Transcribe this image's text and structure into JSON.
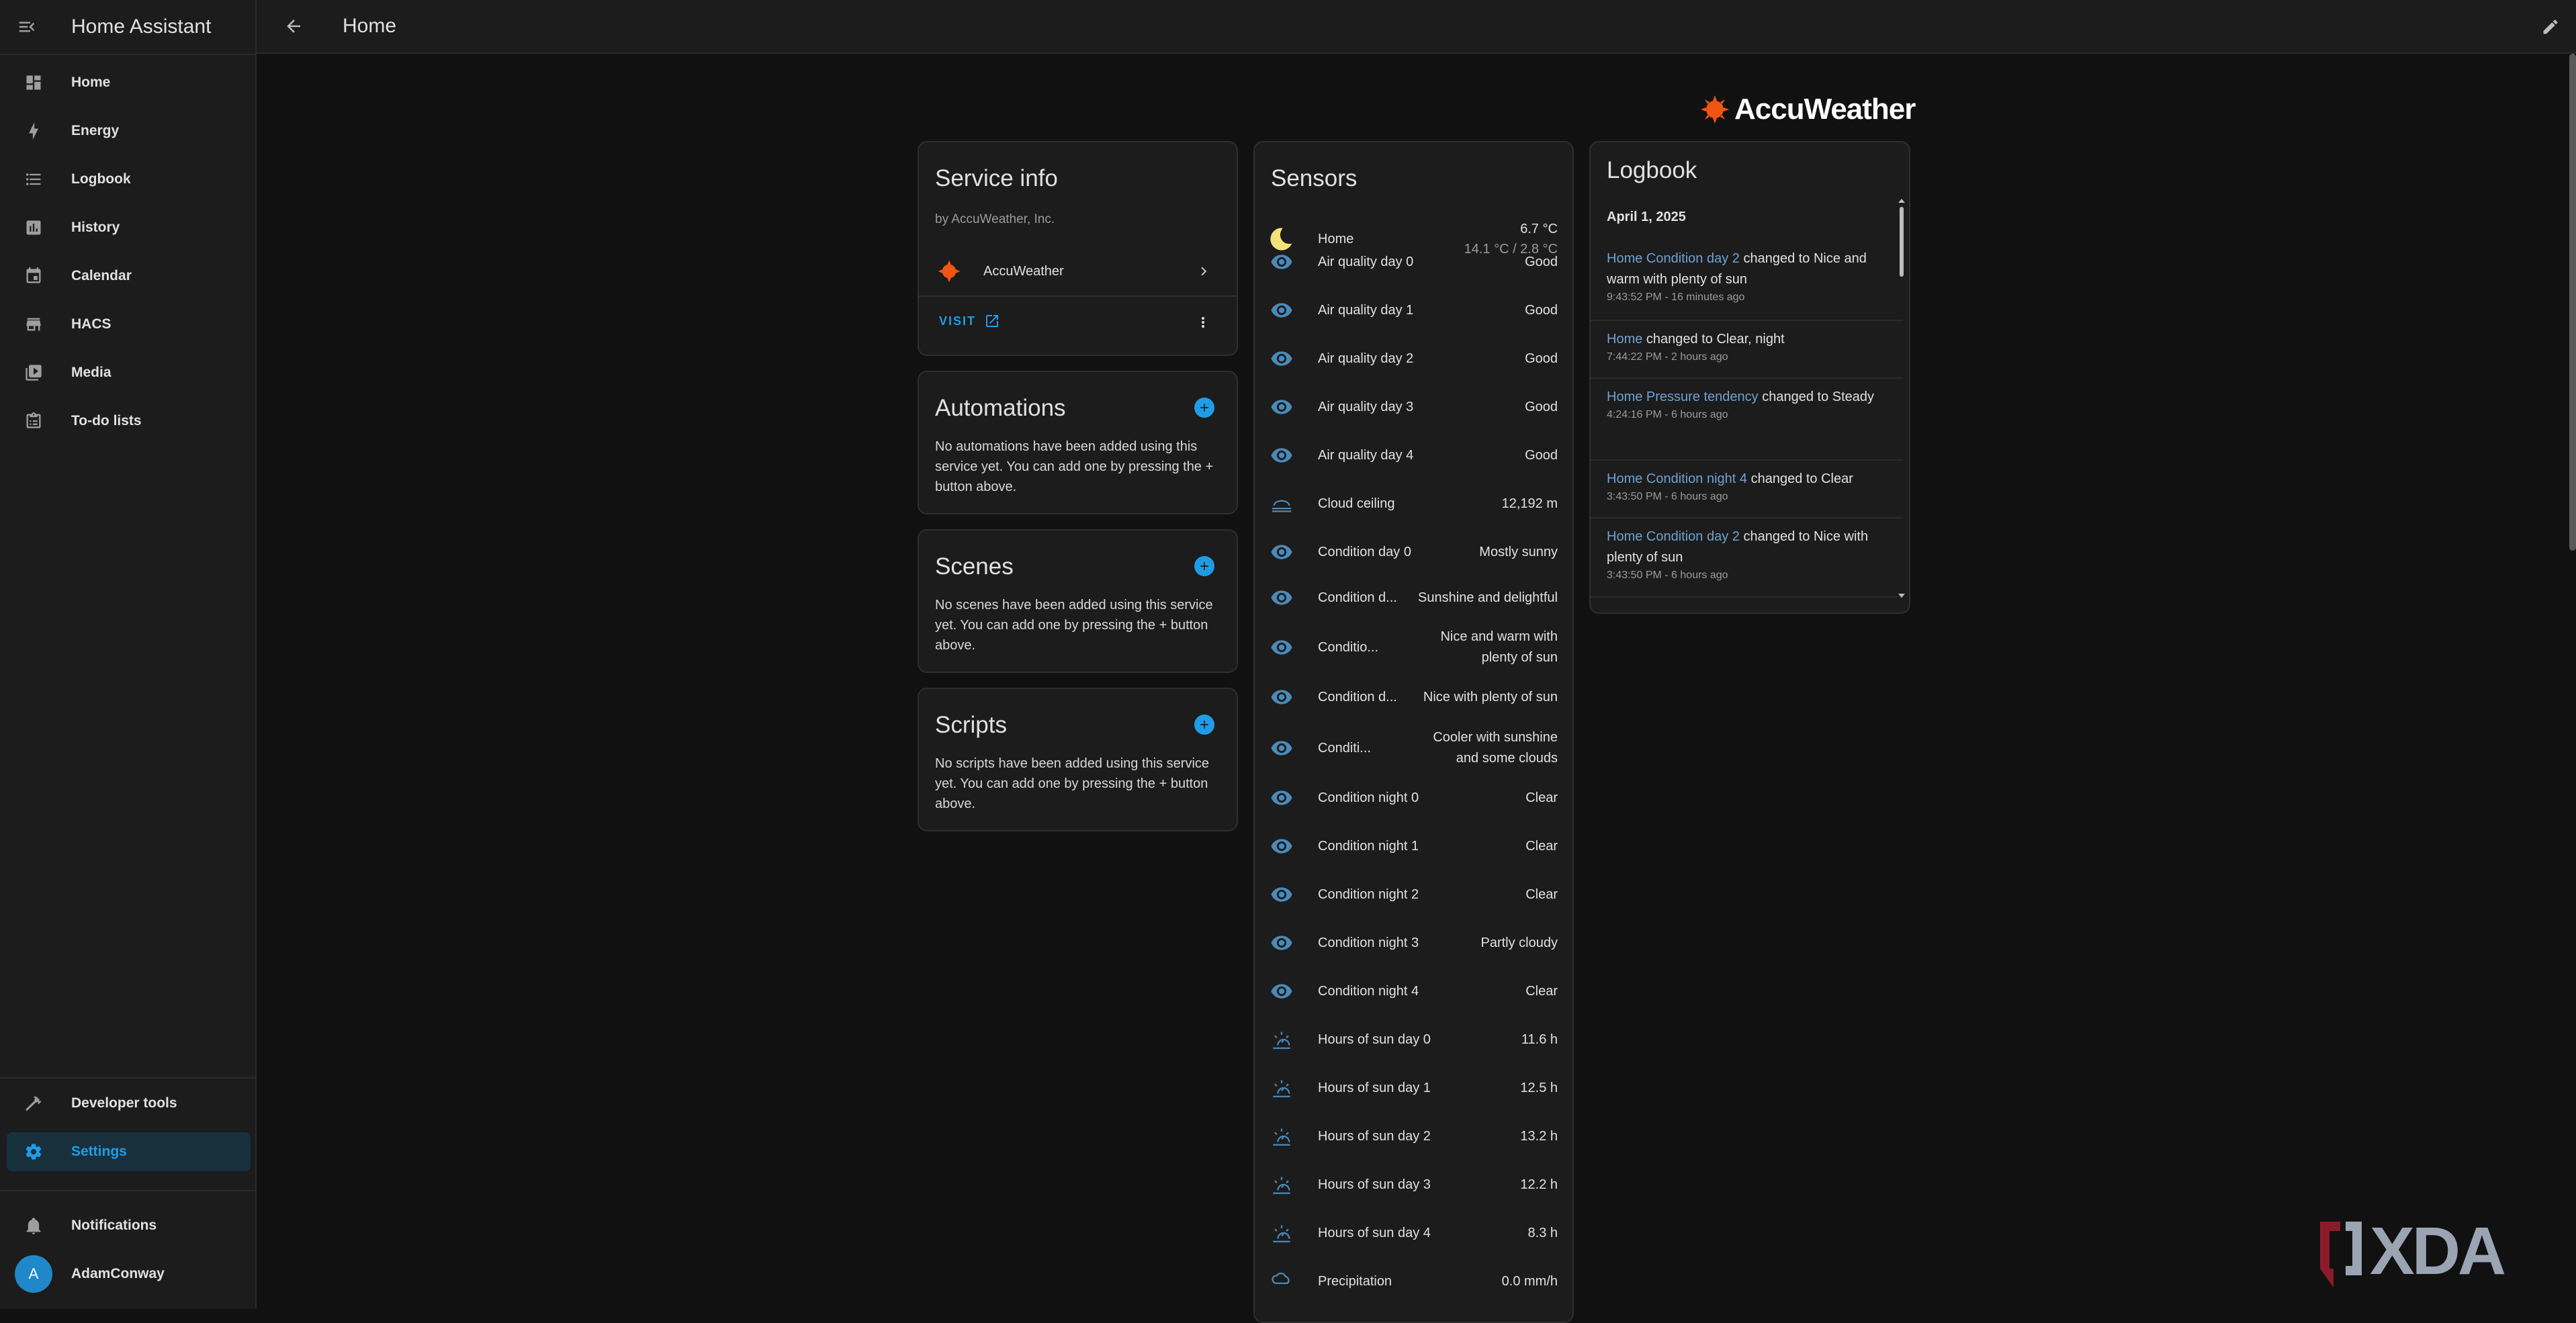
{
  "app": {
    "title": "Home Assistant"
  },
  "sidebar": {
    "items": [
      {
        "label": "Home",
        "icon": "dashboard-icon"
      },
      {
        "label": "Energy",
        "icon": "lightning-icon"
      },
      {
        "label": "Logbook",
        "icon": "list-icon"
      },
      {
        "label": "History",
        "icon": "chart-icon"
      },
      {
        "label": "Calendar",
        "icon": "calendar-icon"
      },
      {
        "label": "HACS",
        "icon": "store-icon"
      },
      {
        "label": "Media",
        "icon": "media-icon"
      },
      {
        "label": "To-do lists",
        "icon": "clipboard-list-icon"
      }
    ],
    "developer_tools": "Developer tools",
    "settings": "Settings",
    "notifications": "Notifications",
    "user_name": "AdamConway",
    "user_initial": "A",
    "accent_color": "#1e9de6"
  },
  "header": {
    "page_title": "Home"
  },
  "brand": {
    "name": "AccuWeather",
    "logo_color": "#f05514"
  },
  "service_info": {
    "title": "Service info",
    "by": "by AccuWeather, Inc.",
    "integration_name": "AccuWeather",
    "visit_label": "VISIT"
  },
  "automations": {
    "title": "Automations",
    "text": "No automations have been added using this service yet. You can add one by pressing the + button above."
  },
  "scenes": {
    "title": "Scenes",
    "text": "No scenes have been added using this service yet. You can add one by pressing the + button above."
  },
  "scripts": {
    "title": "Scripts",
    "text": "No scripts have been added using this service yet. You can add one by pressing the + button above."
  },
  "sensors": {
    "title": "Sensors",
    "home": {
      "name": "Home",
      "temp": "6.7 °C",
      "range": "14.1 °C / 2.8 °C"
    },
    "rows": [
      {
        "name": "Air quality day 0",
        "value": "Good",
        "icon": "eye-icon"
      },
      {
        "name": "Air quality day 1",
        "value": "Good",
        "icon": "eye-icon"
      },
      {
        "name": "Air quality day 2",
        "value": "Good",
        "icon": "eye-icon"
      },
      {
        "name": "Air quality day 3",
        "value": "Good",
        "icon": "eye-icon"
      },
      {
        "name": "Air quality day 4",
        "value": "Good",
        "icon": "eye-icon"
      },
      {
        "name": "Cloud ceiling",
        "value": "12,192 m",
        "icon": "cloud-ceiling-icon"
      },
      {
        "name": "Condition day 0",
        "value": "Mostly sunny",
        "icon": "eye-icon"
      },
      {
        "name": "Condition d...",
        "value": "Sunshine and delightful",
        "icon": "eye-icon"
      },
      {
        "name": "Conditio...",
        "value": "Nice and warm with plenty of sun",
        "icon": "eye-icon"
      },
      {
        "name": "Condition d...",
        "value": "Nice with plenty of sun",
        "icon": "eye-icon"
      },
      {
        "name": "Conditi...",
        "value": "Cooler with sunshine and some clouds",
        "icon": "eye-icon"
      },
      {
        "name": "Condition night 0",
        "value": "Clear",
        "icon": "eye-icon"
      },
      {
        "name": "Condition night 1",
        "value": "Clear",
        "icon": "eye-icon"
      },
      {
        "name": "Condition night 2",
        "value": "Clear",
        "icon": "eye-icon"
      },
      {
        "name": "Condition night 3",
        "value": "Partly cloudy",
        "icon": "eye-icon"
      },
      {
        "name": "Condition night 4",
        "value": "Clear",
        "icon": "eye-icon"
      },
      {
        "name": "Hours of sun day 0",
        "value": "11.6 h",
        "icon": "sun-clock-icon"
      },
      {
        "name": "Hours of sun day 1",
        "value": "12.5 h",
        "icon": "sun-clock-icon"
      },
      {
        "name": "Hours of sun day 2",
        "value": "13.2 h",
        "icon": "sun-clock-icon"
      },
      {
        "name": "Hours of sun day 3",
        "value": "12.2 h",
        "icon": "sun-clock-icon"
      },
      {
        "name": "Hours of sun day 4",
        "value": "8.3 h",
        "icon": "sun-clock-icon"
      },
      {
        "name": "Precipitation",
        "value": "0.0 mm/h",
        "icon": "rain-icon"
      }
    ]
  },
  "logbook": {
    "title": "Logbook",
    "date": "April 1, 2025",
    "entries": [
      {
        "entity": "Home Condition day 2",
        "message": " changed to Nice and warm with plenty of sun",
        "time": "9:43:52 PM - 16 minutes ago"
      },
      {
        "entity": "Home",
        "message": " changed to Clear, night",
        "time": "7:44:22 PM - 2 hours ago"
      },
      {
        "entity": "Home Pressure tendency",
        "message": " changed to Steady",
        "time": "4:24:16 PM - 6 hours ago"
      },
      {
        "entity": "Home Condition night 4",
        "message": " changed to Clear",
        "time": "3:43:50 PM - 6 hours ago"
      },
      {
        "entity": "Home Condition day 2",
        "message": " changed to Nice with plenty of sun",
        "time": "3:43:50 PM - 6 hours ago"
      }
    ]
  },
  "watermark": {
    "text": "XDA"
  }
}
